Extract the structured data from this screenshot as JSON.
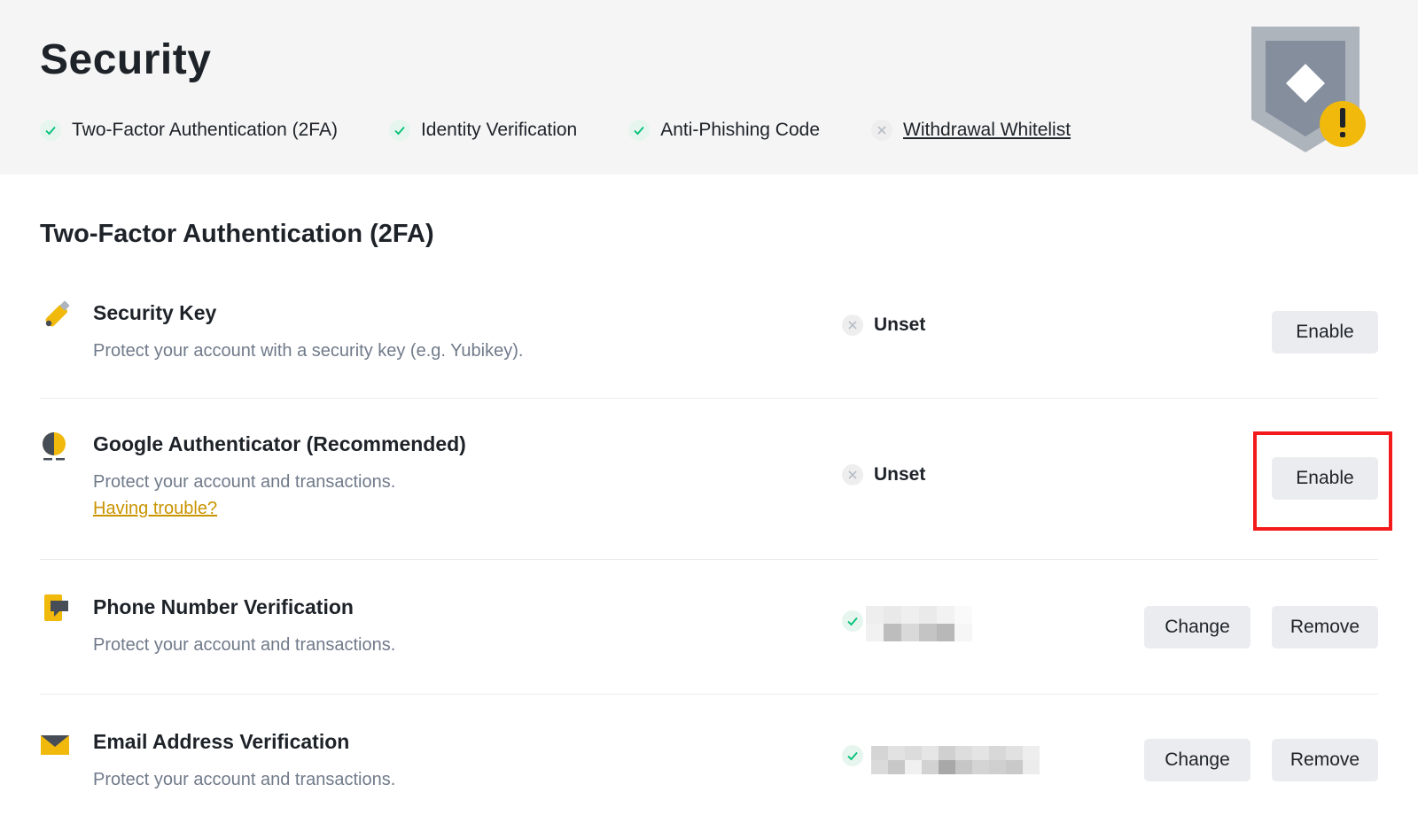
{
  "page": {
    "title": "Security"
  },
  "status_bar": {
    "items": [
      {
        "label": "Two-Factor Authentication (2FA)",
        "state": "done"
      },
      {
        "label": "Identity Verification",
        "state": "done"
      },
      {
        "label": "Anti-Phishing Code",
        "state": "done"
      },
      {
        "label": "Withdrawal Whitelist",
        "state": "not-set"
      }
    ]
  },
  "shield_badge": {
    "icon": "shield-warning-icon",
    "symbol": "!"
  },
  "section": {
    "title": "Two-Factor Authentication (2FA)",
    "rows": [
      {
        "icon": "security-key-icon",
        "title": "Security Key",
        "description": "Protect your account with a security key (e.g. Yubikey).",
        "status": "Unset",
        "actions": [
          "Enable"
        ]
      },
      {
        "icon": "google-authenticator-icon",
        "title": "Google Authenticator (Recommended)",
        "description": "Protect your account and transactions.",
        "link": "Having trouble?",
        "status": "Unset",
        "actions": [
          "Enable"
        ]
      },
      {
        "icon": "phone-icon",
        "title": "Phone Number Verification",
        "description": "Protect your account and transactions.",
        "status": "",
        "actions": [
          "Change",
          "Remove"
        ]
      },
      {
        "icon": "email-icon",
        "title": "Email Address Verification",
        "description": "Protect your account and transactions.",
        "status": "",
        "actions": [
          "Change",
          "Remove"
        ]
      }
    ]
  },
  "colors": {
    "accent_yellow": "#f0b90b",
    "link_gold": "#c99400",
    "success_green": "#02c076",
    "highlight_red": "#f21a1a"
  }
}
